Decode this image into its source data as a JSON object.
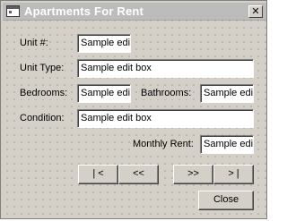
{
  "window": {
    "title": "Apartments For Rent",
    "close_glyph": "✕"
  },
  "labels": {
    "unit_no": "Unit #:",
    "unit_type": "Unit Type:",
    "bedrooms": "Bedrooms:",
    "bathrooms": "Bathrooms:",
    "condition": "Condition:",
    "monthly_rent": "Monthly Rent:"
  },
  "fields": {
    "unit_no": "Sample edi",
    "unit_type": "Sample edit box",
    "bedrooms": "Sample edi",
    "bathrooms": "Sample edi",
    "condition": "Sample edit box",
    "monthly_rent": "Sample edi"
  },
  "buttons": {
    "first": "| <",
    "previous": "<<",
    "next": ">>",
    "last": "> |",
    "close": "Close"
  }
}
